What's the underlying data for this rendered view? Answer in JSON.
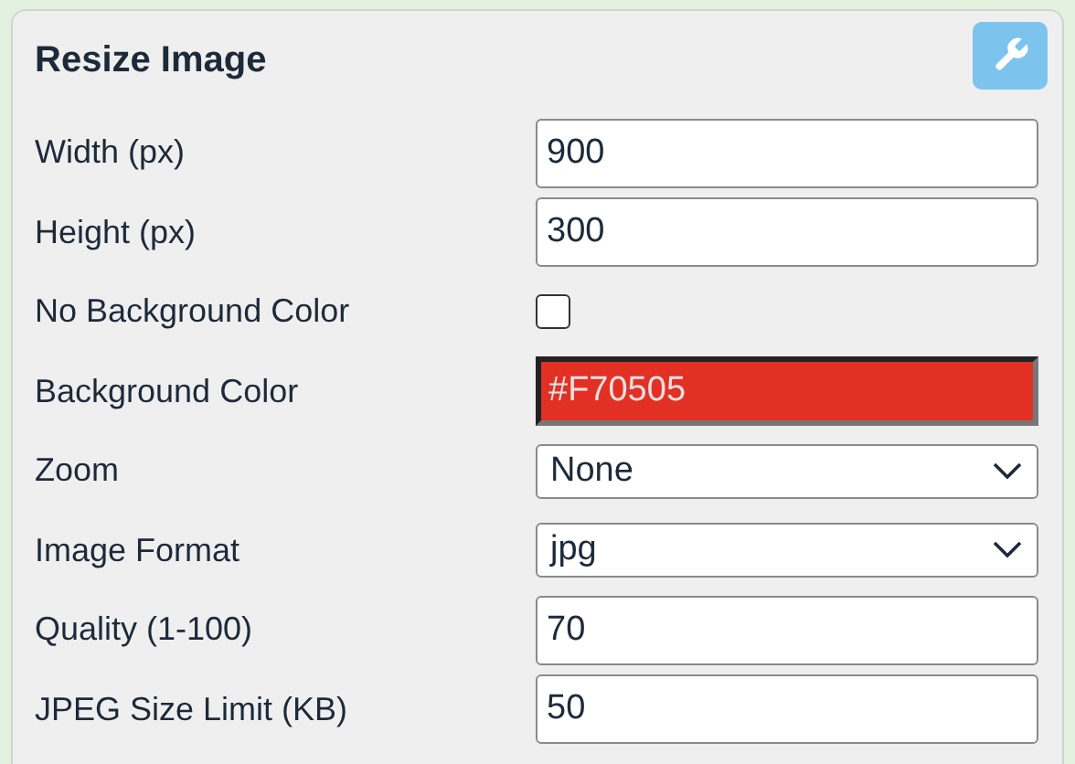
{
  "panel": {
    "title": "Resize Image"
  },
  "fields": [
    {
      "kind": "text",
      "label": "Width (px)",
      "value": "900"
    },
    {
      "kind": "text",
      "label": "Height (px)",
      "value": "300"
    },
    {
      "kind": "checkbox",
      "label": "No Background Color",
      "checked": false
    },
    {
      "kind": "color",
      "label": "Background Color",
      "value": "#F70505",
      "color": "#e33024"
    },
    {
      "kind": "select",
      "label": "Zoom",
      "value": "None"
    },
    {
      "kind": "select",
      "label": "Image Format",
      "value": "jpg"
    },
    {
      "kind": "text",
      "label": "Quality (1-100)",
      "value": "70"
    },
    {
      "kind": "text",
      "label": "JPEG Size Limit (KB)",
      "value": "50"
    }
  ]
}
